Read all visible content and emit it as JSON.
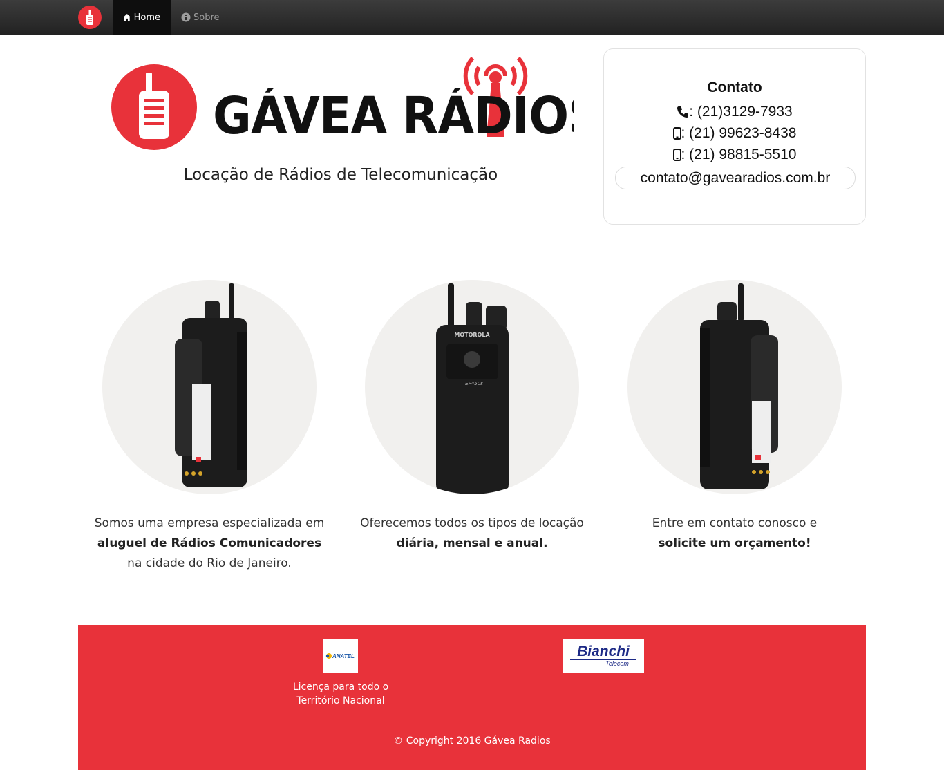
{
  "nav": {
    "home_label": "Home",
    "sobre_label": "Sobre"
  },
  "header": {
    "brand": "GÁVEA RÁDIOS",
    "tagline": "Locação de Rádios de Telecomunicação"
  },
  "contact": {
    "title": "Contato",
    "phone_landline": ": (21)3129-7933",
    "phone_mobile_1": ": (21) 99623-8438",
    "phone_mobile_2": ": (21) 98815-5510",
    "email": "contato@gavearadios.com.br"
  },
  "features": [
    {
      "line1": "Somos uma empresa especializada em",
      "bold": "aluguel de Rádios Comunicadores",
      "line3": "na cidade do Rio de Janeiro."
    },
    {
      "line1": "Oferecemos todos os tipos de locação",
      "bold": "diária, mensal e anual.",
      "line3": ""
    },
    {
      "line1": "Entre em contato conosco e",
      "bold": "solicite um orçamento!",
      "line3": ""
    }
  ],
  "footer": {
    "anatel_logo_text": "ANATEL",
    "anatel_caption_1": "Licença para todo o",
    "anatel_caption_2": "Território Nacional",
    "bianchi_main": "Bianchi",
    "bianchi_sub": "Telecom",
    "copyright": "© Copyright 2016 Gávea Radios"
  },
  "colors": {
    "brand_red": "#e8323a",
    "navbar_dark": "#222222",
    "navbar_active": "#0e0e0e"
  }
}
